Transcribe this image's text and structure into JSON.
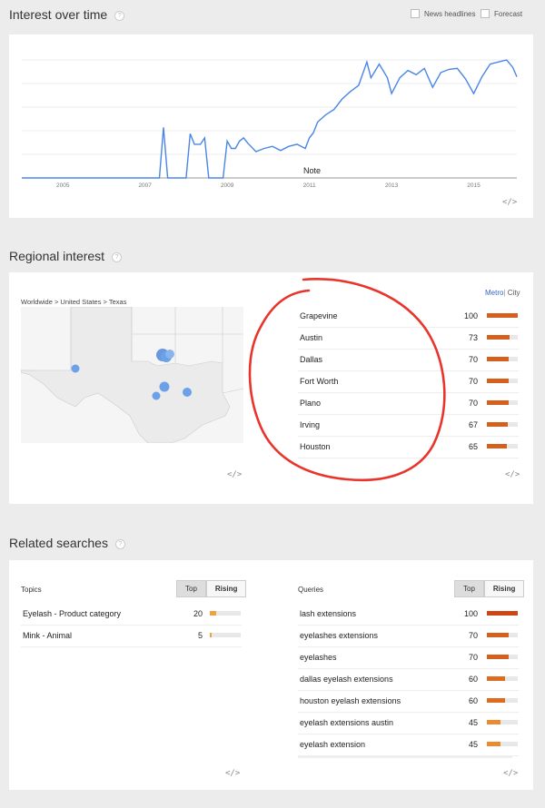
{
  "interest": {
    "title": "Interest over time",
    "help": "?",
    "news_label": "News headlines",
    "forecast_label": "Forecast",
    "note_label": "Note",
    "embed": "</>",
    "chart_data": {
      "type": "line",
      "x_ticks": [
        "2005",
        "2007",
        "2009",
        "2011",
        "2013",
        "2015"
      ],
      "y_range": [
        0,
        100
      ],
      "grid": true,
      "series": [
        {
          "values": [
            [
              2004,
              0
            ],
            [
              2007.35,
              0
            ],
            [
              2007.45,
              48
            ],
            [
              2007.55,
              0
            ],
            [
              2008.0,
              0
            ],
            [
              2008.1,
              42
            ],
            [
              2008.2,
              32
            ],
            [
              2008.35,
              32
            ],
            [
              2008.45,
              38
            ],
            [
              2008.55,
              0
            ],
            [
              2008.9,
              0
            ],
            [
              2009.0,
              35
            ],
            [
              2009.1,
              28
            ],
            [
              2009.2,
              28
            ],
            [
              2009.3,
              35
            ],
            [
              2009.4,
              38
            ],
            [
              2009.5,
              33
            ],
            [
              2009.7,
              25
            ],
            [
              2009.9,
              28
            ],
            [
              2010.1,
              30
            ],
            [
              2010.3,
              26
            ],
            [
              2010.5,
              30
            ],
            [
              2010.7,
              32
            ],
            [
              2010.9,
              28
            ],
            [
              2011.0,
              38
            ],
            [
              2011.1,
              43
            ],
            [
              2011.2,
              53
            ],
            [
              2011.4,
              60
            ],
            [
              2011.6,
              65
            ],
            [
              2011.8,
              75
            ],
            [
              2012.0,
              82
            ],
            [
              2012.2,
              88
            ],
            [
              2012.4,
              110
            ],
            [
              2012.5,
              95
            ],
            [
              2012.7,
              108
            ],
            [
              2012.9,
              95
            ],
            [
              2013.0,
              80
            ],
            [
              2013.2,
              95
            ],
            [
              2013.4,
              102
            ],
            [
              2013.6,
              98
            ],
            [
              2013.8,
              104
            ],
            [
              2014.0,
              86
            ],
            [
              2014.2,
              100
            ],
            [
              2014.4,
              103
            ],
            [
              2014.6,
              104
            ],
            [
              2014.8,
              94
            ],
            [
              2015.0,
              80
            ],
            [
              2015.2,
              96
            ],
            [
              2015.4,
              108
            ],
            [
              2015.6,
              110
            ],
            [
              2015.8,
              112
            ],
            [
              2015.95,
              105
            ],
            [
              2016.05,
              96
            ]
          ]
        }
      ]
    }
  },
  "regional": {
    "title": "Regional interest",
    "help": "?",
    "breadcrumb": "Worldwide > United States > Texas",
    "metro_label": "Metro",
    "city_label": "City",
    "embed": "</>",
    "map_accent": "#6ba1e8",
    "bar_color": "#d5601d",
    "rows": [
      {
        "name": "Grapevine",
        "value": "100",
        "pct": 100
      },
      {
        "name": "Austin",
        "value": "73",
        "pct": 73
      },
      {
        "name": "Dallas",
        "value": "70",
        "pct": 70
      },
      {
        "name": "Fort Worth",
        "value": "70",
        "pct": 70
      },
      {
        "name": "Plano",
        "value": "70",
        "pct": 70
      },
      {
        "name": "Irving",
        "value": "67",
        "pct": 67
      },
      {
        "name": "Houston",
        "value": "65",
        "pct": 65
      }
    ]
  },
  "related": {
    "title": "Related searches",
    "help": "?",
    "topics": {
      "header": "Topics",
      "top_label": "Top",
      "rising_label": "Rising",
      "embed": "</>",
      "bar_color": "#f0a23f",
      "rows": [
        {
          "name": "Eyelash - Product category",
          "value": "20",
          "pct": 20
        },
        {
          "name": "Mink - Animal",
          "value": "5",
          "pct": 5
        }
      ]
    },
    "queries": {
      "header": "Queries",
      "top_label": "Top",
      "rising_label": "Rising",
      "embed": "</>",
      "rows": [
        {
          "name": "lash extensions",
          "value": "100",
          "pct": 100,
          "color": "#cf4513"
        },
        {
          "name": "eyelashes extensions",
          "value": "70",
          "pct": 70,
          "color": "#d5601d"
        },
        {
          "name": "eyelashes",
          "value": "70",
          "pct": 70,
          "color": "#d5601d"
        },
        {
          "name": "dallas eyelash extensions",
          "value": "60",
          "pct": 60,
          "color": "#dd6b22"
        },
        {
          "name": "houston eyelash extensions",
          "value": "60",
          "pct": 60,
          "color": "#dd6b22"
        },
        {
          "name": "eyelash extensions austin",
          "value": "45",
          "pct": 45,
          "color": "#eb8a2c"
        },
        {
          "name": "eyelash extension",
          "value": "45",
          "pct": 45,
          "color": "#eb8a2c"
        }
      ]
    }
  }
}
